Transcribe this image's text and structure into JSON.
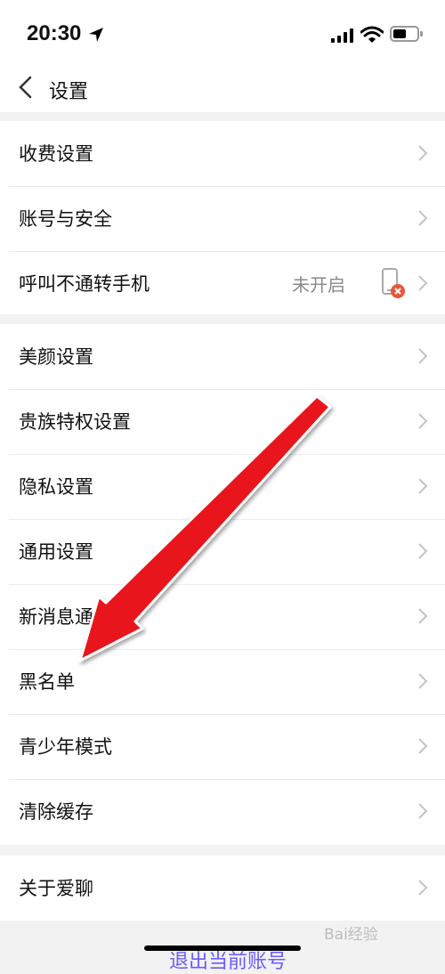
{
  "status": {
    "time": "20:30"
  },
  "nav": {
    "title": "设置"
  },
  "groups": [
    {
      "items": [
        {
          "label": "收费设置"
        },
        {
          "label": "账号与安全"
        },
        {
          "label": "呼叫不通转手机",
          "value": "未开启"
        }
      ]
    },
    {
      "items": [
        {
          "label": "美颜设置"
        },
        {
          "label": "贵族特权设置"
        },
        {
          "label": "隐私设置"
        },
        {
          "label": "通用设置"
        },
        {
          "label": "新消息通知"
        },
        {
          "label": "黑名单"
        },
        {
          "label": "青少年模式"
        },
        {
          "label": "清除缓存"
        }
      ]
    },
    {
      "items": [
        {
          "label": "关于爱聊"
        }
      ]
    }
  ],
  "logout": {
    "label": "退出当前账号"
  },
  "watermark": {
    "text": "Bai经验"
  },
  "colors": {
    "accent": "#6a5bff",
    "arrow": "#e8141b",
    "badge": "#e8573c"
  }
}
